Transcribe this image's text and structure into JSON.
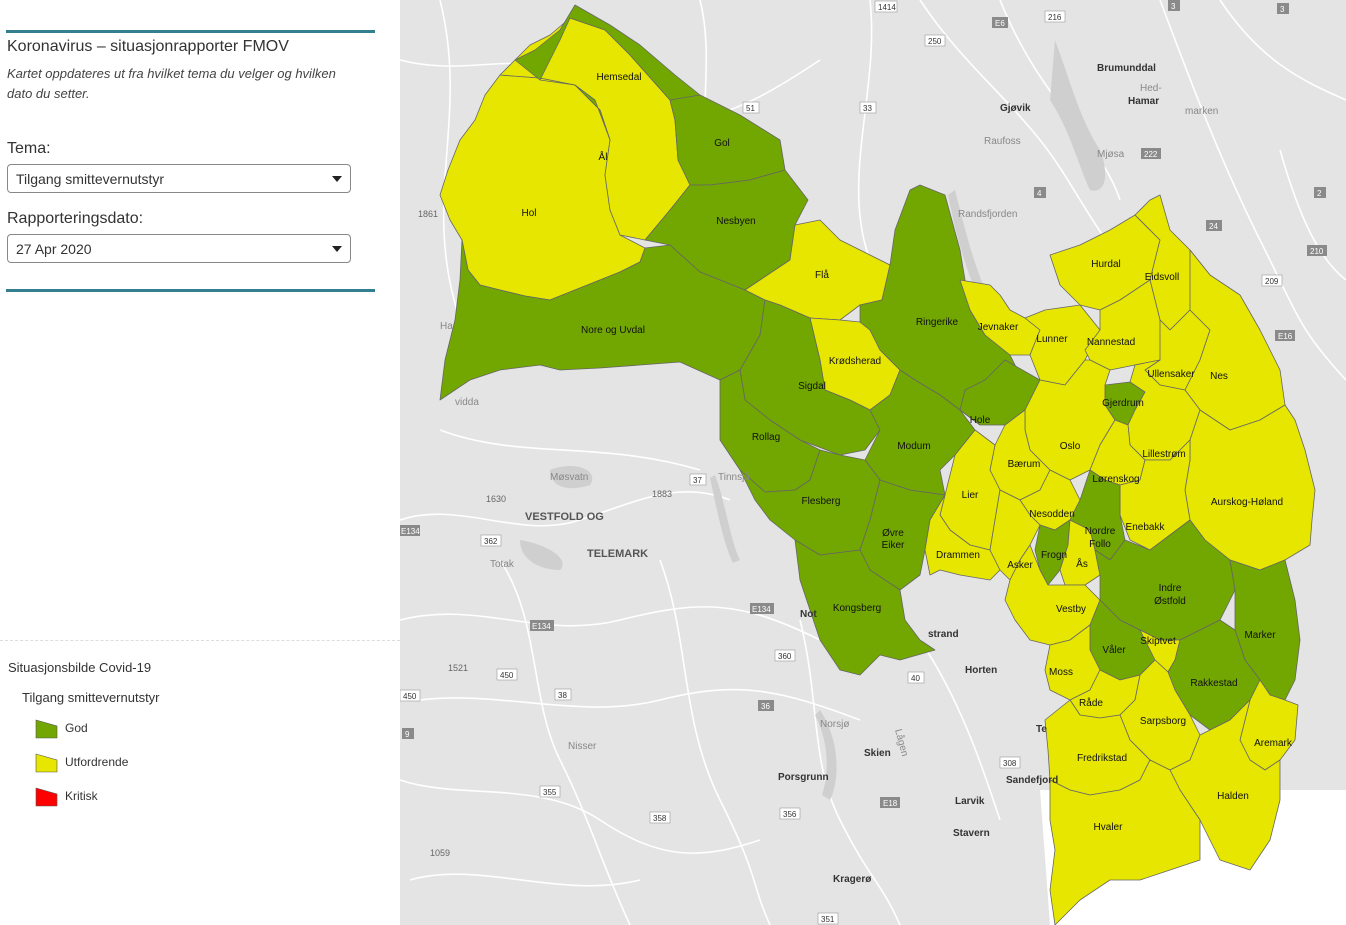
{
  "panel": {
    "title": "Koronavirus – situasjonrapporter FMOV",
    "description": "Kartet oppdateres ut fra hvilket tema du velger og hvilken dato du setter.",
    "theme_label": "Tema:",
    "theme_value": "Tilgang smittevernutstyr",
    "date_label": "Rapporteringsdato:",
    "date_value": "27 Apr 2020"
  },
  "legend": {
    "title": "Situasjonsbilde Covid-19",
    "subtitle": "Tilgang smittevernutstyr",
    "items": [
      {
        "label": "God",
        "color": "#72a600"
      },
      {
        "label": "Utfordrende",
        "color": "#e6e600"
      },
      {
        "label": "Kritisk",
        "color": "#ff0000"
      }
    ]
  },
  "map": {
    "colors": {
      "good": "#72a600",
      "challenging": "#e6e600",
      "critical": "#ff0000",
      "border": "#666666",
      "background": "#e4e4e4"
    },
    "municipalities": {
      "hemsedal": {
        "name": "Hemsedal",
        "status": "God"
      },
      "aal": {
        "name": "Ål",
        "status": "Utfordrende"
      },
      "gol": {
        "name": "Gol",
        "status": "God"
      },
      "hol": {
        "name": "Hol",
        "status": "Utfordrende"
      },
      "nesbyen": {
        "name": "Nesbyen",
        "status": "God"
      },
      "flaa": {
        "name": "Flå",
        "status": "Utfordrende"
      },
      "nore_og_uvdal": {
        "name": "Nore og Uvdal",
        "status": "God"
      },
      "kroedsherad": {
        "name": "Krødsherad",
        "status": "Utfordrende"
      },
      "ringerike": {
        "name": "Ringerike",
        "status": "God"
      },
      "sigdal": {
        "name": "Sigdal",
        "status": "God"
      },
      "rollag": {
        "name": "Rollag",
        "status": "God"
      },
      "modum": {
        "name": "Modum",
        "status": "God"
      },
      "hole": {
        "name": "Hole",
        "status": "God"
      },
      "flesberg": {
        "name": "Flesberg",
        "status": "God"
      },
      "oevre_eiker": {
        "name": "Øvre Eiker",
        "status": "God"
      },
      "kongsberg": {
        "name": "Kongsberg",
        "status": "God"
      },
      "jevnaker": {
        "name": "Jevnaker",
        "status": "Utfordrende"
      },
      "lunner": {
        "name": "Lunner",
        "status": "Utfordrende"
      },
      "hurdal": {
        "name": "Hurdal",
        "status": "Utfordrende"
      },
      "eidsvoll": {
        "name": "Eidsvoll",
        "status": "Utfordrende"
      },
      "nannestad": {
        "name": "Nannestad",
        "status": "Utfordrende"
      },
      "ullensaker": {
        "name": "Ullensaker",
        "status": "Utfordrende"
      },
      "nes": {
        "name": "Nes",
        "status": "Utfordrende"
      },
      "gjerdrum": {
        "name": "Gjerdrum",
        "status": "God"
      },
      "oslo": {
        "name": "Oslo",
        "status": "Utfordrende"
      },
      "lillestroem": {
        "name": "Lillestrøm",
        "status": "Utfordrende"
      },
      "baerum": {
        "name": "Bærum",
        "status": "Utfordrende"
      },
      "loerenskog": {
        "name": "Lørenskog",
        "status": "Utfordrende"
      },
      "aurskog_hoeland": {
        "name": "Aurskog-Høland",
        "status": "Utfordrende"
      },
      "lier": {
        "name": "Lier",
        "status": "Utfordrende"
      },
      "nesodden": {
        "name": "Nesodden",
        "status": "Utfordrende"
      },
      "enebakk": {
        "name": "Enebakk",
        "status": "Utfordrende"
      },
      "nordre_follo": {
        "name": "Nordre Follo",
        "status": "God"
      },
      "drammen": {
        "name": "Drammen",
        "status": "Utfordrende"
      },
      "asker": {
        "name": "Asker",
        "status": "Utfordrende"
      },
      "frogn": {
        "name": "Frogn",
        "status": "God"
      },
      "aas": {
        "name": "Ås",
        "status": "Utfordrende"
      },
      "indre_oestfold": {
        "name": "Indre Østfold",
        "status": "God"
      },
      "vestby": {
        "name": "Vestby",
        "status": "Utfordrende"
      },
      "marker": {
        "name": "Marker",
        "status": "God"
      },
      "skiptvet": {
        "name": "Skiptvet",
        "status": "Utfordrende"
      },
      "vaaler": {
        "name": "Våler",
        "status": "God"
      },
      "moss": {
        "name": "Moss",
        "status": "Utfordrende"
      },
      "rakkestad": {
        "name": "Rakkestad",
        "status": "God"
      },
      "raade": {
        "name": "Råde",
        "status": "Utfordrende"
      },
      "sarpsborg": {
        "name": "Sarpsborg",
        "status": "Utfordrende"
      },
      "aremark": {
        "name": "Aremark",
        "status": "Utfordrende"
      },
      "fredrikstad": {
        "name": "Fredrikstad",
        "status": "Utfordrende"
      },
      "halden": {
        "name": "Halden",
        "status": "Utfordrende"
      },
      "hvaler": {
        "name": "Hvaler",
        "status": "Utfordrende"
      }
    },
    "places": {
      "brumunddal": "Brumunddal",
      "hamar": "Hed-\nHamar",
      "marken": "marken",
      "gjoevik": "Gjøvik",
      "raufoss": "Raufoss",
      "mjoesa": "Mjøsa",
      "randsfjorden": "Randsfjorden",
      "vestfold_telemark_1": "VESTFOLD OG",
      "vestfold_telemark_2": "TELEMARK",
      "vidda": "vidda",
      "moesvatn": "Møsvatn",
      "tinnsjaa": "Tinnsjå",
      "totak": "Totak",
      "norsjoe": "Norsjø",
      "nisser": "Nisser",
      "skien": "Skien",
      "porsgrunn": "Porsgrunn",
      "larvik": "Larvik",
      "sandefjord": "Sandefjord",
      "horten": "Horten",
      "stavern": "Stavern",
      "krageroe": "Kragerø",
      "tmp_strand": "strand",
      "notodden": "Not",
      "ha": "Ha",
      "lagen": "Lågen",
      "te": "Te"
    },
    "roads": {
      "r1414": "1414",
      "e6": "E6",
      "r216": "216",
      "r3": "3",
      "r250": "250",
      "r51": "51",
      "r33": "33",
      "r222": "222",
      "r4": "4",
      "r24": "24",
      "r210": "210",
      "r209": "209",
      "e16": "E16",
      "r2": "2",
      "r37": "37",
      "r362": "362",
      "e134a": "E134",
      "e134b": "E134",
      "e134c": "E134",
      "r360": "360",
      "r450a": "450",
      "r450b": "450",
      "r38": "38",
      "r40": "40",
      "r36": "36",
      "r9": "9",
      "r308": "308",
      "r356": "356",
      "r358": "358",
      "r355": "355",
      "e18": "E18",
      "r351": "351"
    },
    "elevations": {
      "e1861": "1861",
      "e1630": "1630",
      "e1883": "1883",
      "e1521": "1521",
      "e1059": "1059"
    }
  }
}
